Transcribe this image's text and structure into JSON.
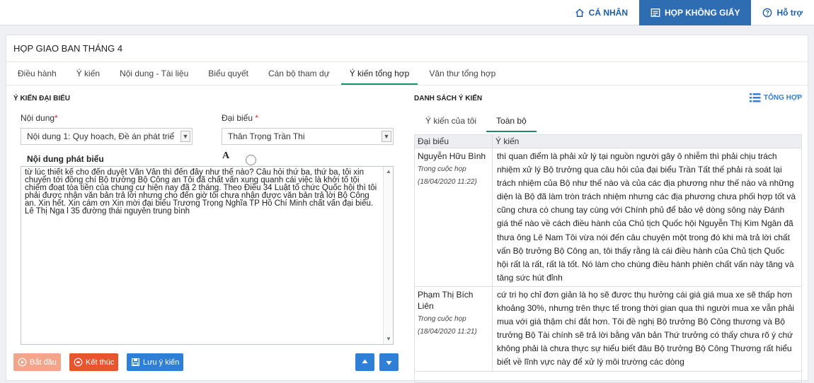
{
  "topnav": {
    "personal": "CÁ NHÂN",
    "paperless": "HỌP KHÔNG GIẤY",
    "support": "Hỗ trợ"
  },
  "meeting": {
    "title": "HỌP GIAO BAN THÁNG 4"
  },
  "tabs": [
    {
      "label": "Điều hành"
    },
    {
      "label": "Ý kiến"
    },
    {
      "label": "Nội dung - Tài liệu"
    },
    {
      "label": "Biểu quyết"
    },
    {
      "label": "Cán bộ tham dự"
    },
    {
      "label": "Ý kiến tổng hợp"
    },
    {
      "label": "Văn thư tổng hợp"
    }
  ],
  "left": {
    "section_title": "Ý KIẾN ĐẠI BIỂU",
    "content_label": "Nội dung",
    "content_value": "Nội dung 1: Quy hoạch, Đề án phát triể",
    "delegate_label": "Đại biểu",
    "delegate_value": "Thân Trọng Trần Thi",
    "speech_label": "Nội dung phát biểu",
    "font_glyph": "A",
    "speech_text": "từ lúc thiết kế cho đến duyệt Văn Vân thì đến đây như thế nào? Câu hỏi thứ ba, thứ ba, tôi xin chuyển tới đồng chí Bộ trưởng Bộ Công an Tôi đã chất vấn xung quanh cái việc là khởi tố tội chiếm đoạt tòa tiền của chung cư hiện nay đã 2 tháng. Theo Điều 34 Luật tổ chức Quốc hội thì tôi phải được nhận văn bản trả lời nhưng cho đến giờ tôi chưa nhận được văn bản trả lời Bộ Công an. Xin hết. Xin cám ơn Xin mời đại biểu Trương Trọng Nghĩa TP Hồ Chí Minh chất vấn đại biểu. Lê Thị Nga l 35 đường thái nguyên trung bình",
    "btn_start": "Bắt đầu",
    "btn_stop": "Kết thúc",
    "btn_save": "Lưu ý kiến"
  },
  "right": {
    "section_title": "DANH SÁCH Ý KIẾN",
    "summary": "TỔNG HỢP",
    "subtabs": [
      {
        "label": "Ý kiến của tôi"
      },
      {
        "label": "Toàn bộ"
      }
    ],
    "col_delegate": "Đại biểu",
    "col_opinion": "Ý kiến",
    "rows": [
      {
        "name": "Nguyễn Hữu Bình",
        "where": "Trong cuộc họp",
        "time": "(18/04/2020 11:22)",
        "text": "thì quan điểm là phải xử lý tại nguồn người gây ô nhiễm thì phải chịu trách nhiệm xử lý Bộ trưởng qua câu hỏi của đại biểu Trần Tất thế phải rà soát lại trách nhiệm của Bộ như thế nào và của các địa phương như thế nào và những diện là Bộ đã làm tròn trách nhiệm nhưng các địa phương chưa phối hợp tốt và cũng chưa có chung tay cùng với Chính phủ để bảo vệ dòng sông này Đánh giá thế nào về cách điều hành của Chủ tịch Quốc hội Nguyễn Thị Kim Ngân đã thưa ông Lê Nam Tôi vừa nói đến câu chuyện một trong đó khi mà trả lời chất vấn Bộ trưởng Bộ Công an, tôi thấy rằng là cái điều hành của Chủ tịch Quốc hội rất là rất, rất là tốt. Nó làm cho chúng điều hành phiên chất vấn này tăng và tăng sức hút đỉnh"
      },
      {
        "name": "Phạm Thị Bích Liên",
        "where": "Trong cuộc họp",
        "time": "(18/04/2020 11:21)",
        "text": "cứ tri họ chỉ đơn giản là họ sẽ được thụ hưởng cái giá giá mua xe sẽ thấp hơn khoảng 30%, nhưng trên thực tế trong thời gian qua thì người mua xe vẫn phải mua với giá thậm chí đắt hơn. Tôi đề nghị Bộ trưởng Bộ Công thương và Bộ trưởng Bộ Tài chính sẽ trả lời bằng văn bản Thứ trưởng có thấy chưa rõ ý chứ không phải là chưa thực sự hiểu biết đâu Bộ trưởng Bộ Công Thương rất hiểu biết về lĩnh vực này để xử lý môi trường các dòng"
      }
    ]
  },
  "colors": {
    "accent_blue": "#2f7fd6",
    "nav_active": "#2f6db3",
    "tab_underline": "#1e8a6e",
    "start_btn": "#f3a58c",
    "stop_btn": "#e8542e"
  }
}
